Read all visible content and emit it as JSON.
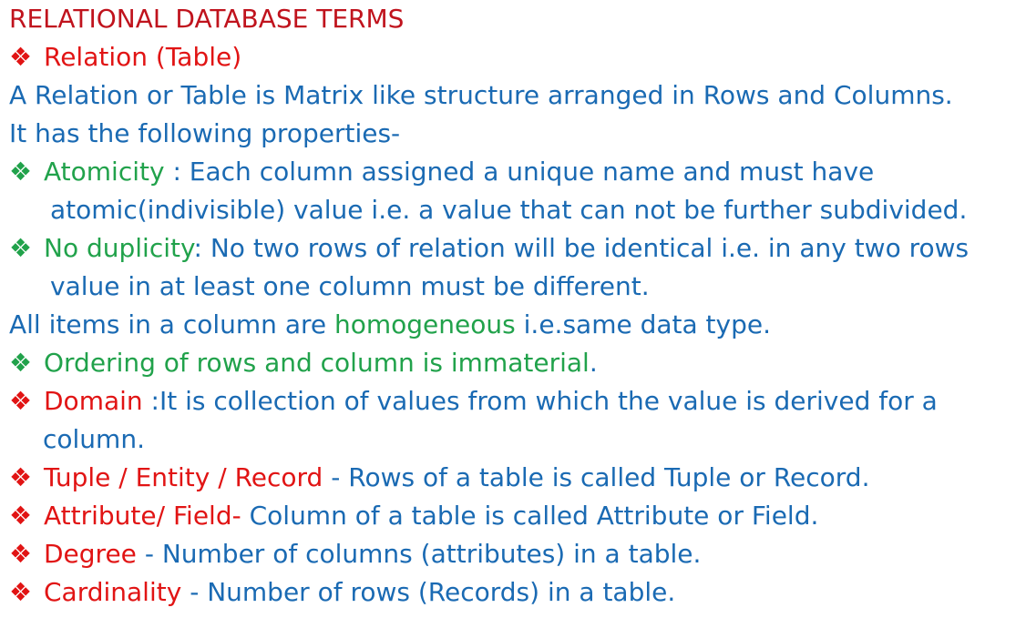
{
  "title": "RELATIONAL DATABASE TERMS",
  "bullet_glyph": "❖",
  "relation": {
    "term": "Relation (Table)"
  },
  "desc1": "A Relation or Table is Matrix like structure arranged in Rows and Columns.",
  "desc2": "It has the following properties-",
  "atomicity": {
    "term": "Atomicity",
    "text_a": " : Each column assigned a unique name and must have",
    "text_b": "atomic(indivisible) value i.e. a value that can not be further subdivided."
  },
  "duplicity": {
    "term": "No duplicity",
    "text_a": ": No two rows of relation will be identical i.e. in any two rows",
    "text_b": "value in at least one column must be different."
  },
  "homog": {
    "pre": "All items in a column are ",
    "term": "homogeneous",
    "post": " i.e.same data type."
  },
  "ordering": {
    "term": "Ordering",
    "mid": " of rows and column is ",
    "term2": "immaterial",
    "post": "."
  },
  "domain": {
    "term": "Domain",
    "text_a": " :It is collection of values from which the value is derived for a",
    "text_b": "column."
  },
  "tuple": {
    "term": "Tuple / Entity / Record",
    "text": " - Rows of a table is called Tuple or Record."
  },
  "attribute": {
    "term": "Attribute/ Field-",
    "text": " Column of a table is called Attribute or Field."
  },
  "degree": {
    "term": "Degree",
    "text": " - Number of columns (attributes) in a table."
  },
  "cardinality": {
    "term": "Cardinality",
    "text": " - Number of rows (Records) in a table."
  },
  "colors": {
    "blue": "#1a6ab3",
    "red": "#e11414",
    "green": "#21a24b",
    "title": "#c0131d"
  }
}
